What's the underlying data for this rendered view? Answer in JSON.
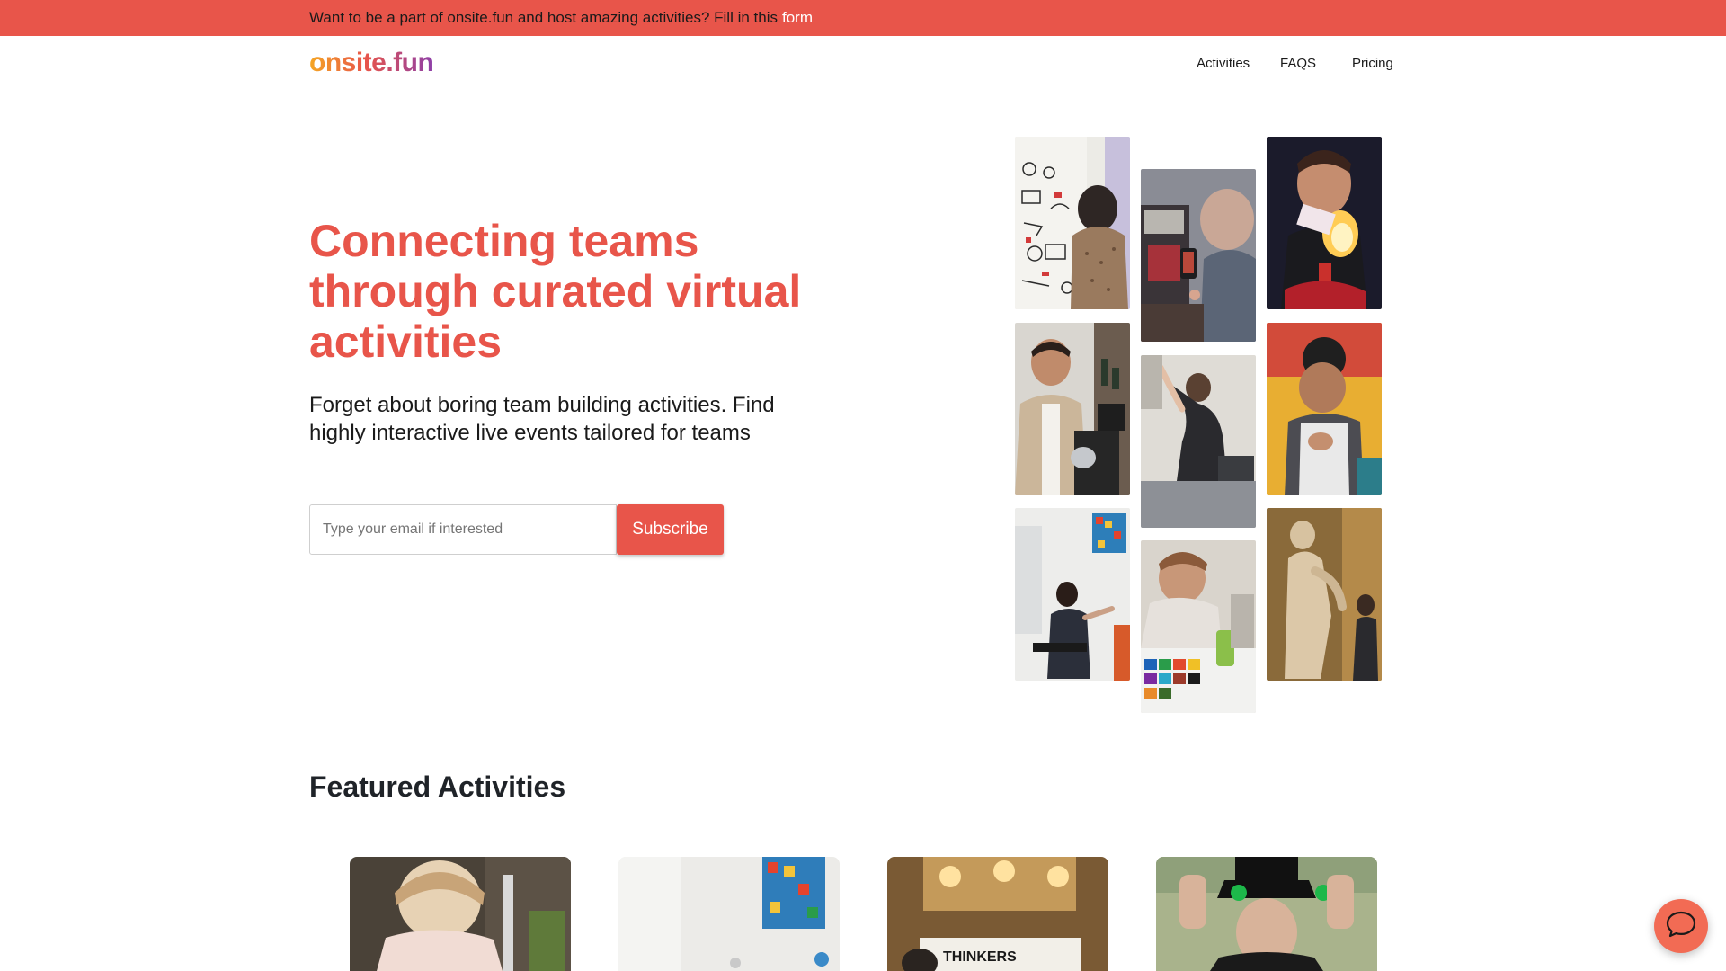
{
  "banner": {
    "text": "Want to be a part of onsite.fun and host amazing activities? Fill in this",
    "link": "form"
  },
  "header": {
    "logo": "onsite.fun",
    "nav": [
      "Activities",
      "FAQS",
      "Pricing"
    ]
  },
  "hero": {
    "title": "Connecting teams through curated virtual activities",
    "subtitle": "Forget about boring team building activities. Find highly interactive live events tailored for teams",
    "email_placeholder": "Type your email if interested",
    "subscribe_label": "Subscribe"
  },
  "collage": {
    "tiles": [
      {
        "name": "whiteboard-sketch-photo"
      },
      {
        "name": "puzzle-game-photo"
      },
      {
        "name": "magic-fire-card-photo"
      },
      {
        "name": "mixology-host-photo"
      },
      {
        "name": "yoga-stretch-photo"
      },
      {
        "name": "chef-cooking-photo"
      },
      {
        "name": "online-painter-photo"
      },
      {
        "name": "watercolor-painting-photo"
      },
      {
        "name": "museum-tour-photo"
      }
    ]
  },
  "featured": {
    "title": "Featured Activities",
    "cards": [
      {
        "name": "watercolor-class-card"
      },
      {
        "name": "art-studio-card"
      },
      {
        "name": "thinkers-escape-room-card",
        "text": "THINKERS"
      },
      {
        "name": "magician-show-card"
      }
    ]
  },
  "colors": {
    "accent": "#e8554a",
    "logo_gradient": [
      "#f5a623",
      "#e8554a",
      "#8e3fa8"
    ],
    "text": "#1f2328"
  },
  "icons": {
    "chat": "chat-bubble-icon"
  }
}
